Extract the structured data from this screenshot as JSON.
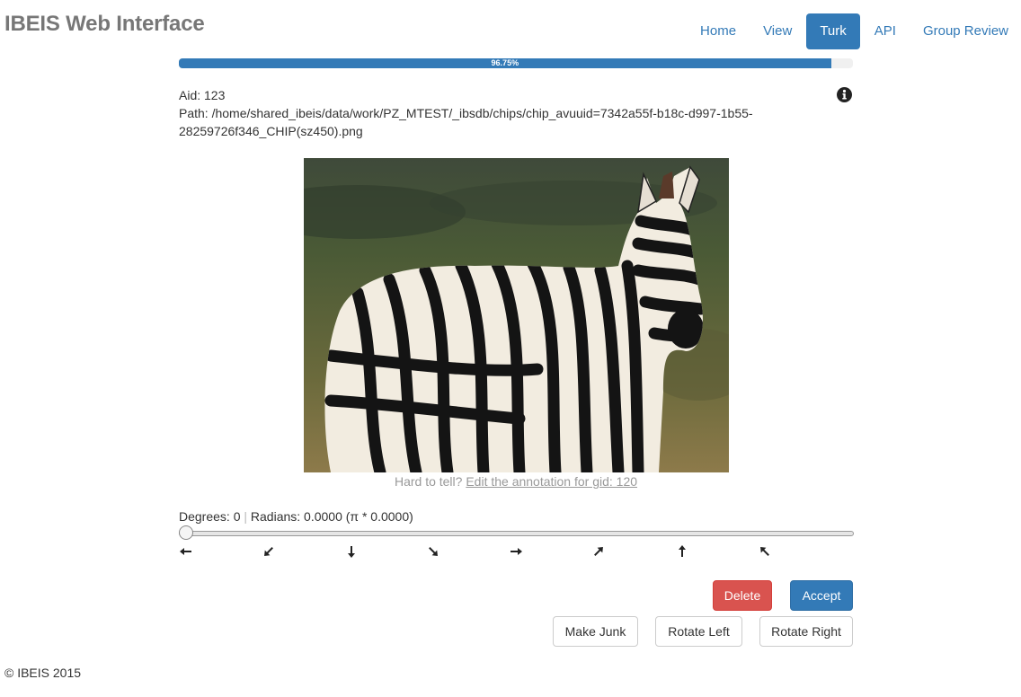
{
  "brand": "IBEIS Web Interface",
  "nav": [
    {
      "label": "Home",
      "active": false
    },
    {
      "label": "View",
      "active": false
    },
    {
      "label": "Turk",
      "active": true
    },
    {
      "label": "API",
      "active": false
    },
    {
      "label": "Group Review",
      "active": false
    }
  ],
  "progress": {
    "fraction": 0.9675,
    "label": "96.75%"
  },
  "annotation": {
    "aid_text": "Aid: 123",
    "path_text": "Path: /home/shared_ibeis/data/work/PZ_MTEST/_ibsdb/chips/chip_avuuid=7342a55f-b18c-d997-1b55-28259726f346_CHIP(sz450).png"
  },
  "info_icon": "info-circle-icon",
  "hint": {
    "prefix": "Hard to tell?",
    "link": "Edit the annotation for gid: 120"
  },
  "rotation": {
    "degrees_text": "Degrees: 0",
    "separator": "|",
    "radians_text": "Radians: 0.0000 (π * 0.0000)",
    "slider_value": 0
  },
  "direction_icons": [
    "arrow-left-icon",
    "arrow-down-left-icon",
    "arrow-down-icon",
    "arrow-down-right-icon",
    "arrow-right-icon",
    "arrow-up-right-icon",
    "arrow-up-icon",
    "arrow-up-left-icon"
  ],
  "buttons": {
    "delete": "Delete",
    "accept": "Accept",
    "make_junk": "Make Junk",
    "rotate_left": "Rotate Left",
    "rotate_right": "Rotate Right"
  },
  "colors": {
    "primary": "#337ab7",
    "danger": "#d9534f"
  },
  "footer": "© IBEIS 2015"
}
